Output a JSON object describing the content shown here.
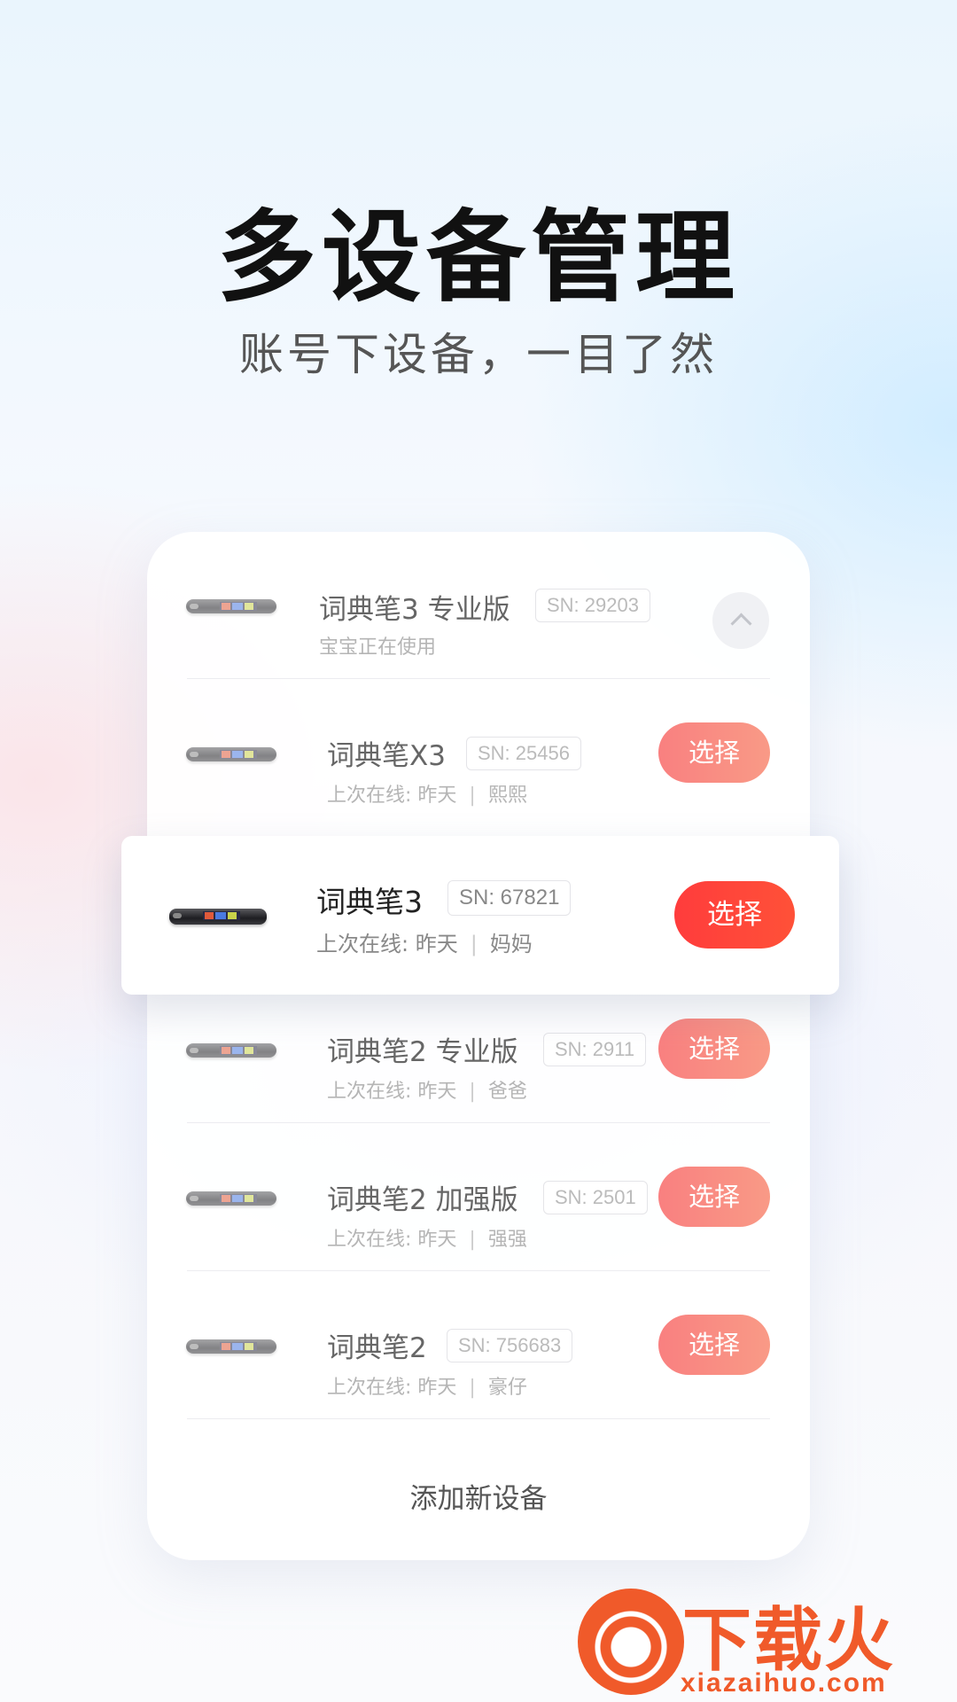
{
  "hero": {
    "title": "多设备管理",
    "subtitle": "账号下设备，一目了然"
  },
  "current_device": {
    "name": "词典笔3 专业版",
    "sn": "SN: 29203",
    "status": "宝宝正在使用"
  },
  "devices": [
    {
      "name": "词典笔X3",
      "sn": "SN: 25456",
      "last_online": "上次在线: 昨天",
      "separator": "|",
      "user": "熙熙",
      "button": "选择"
    },
    {
      "name": "词典笔3",
      "sn": "SN: 67821",
      "last_online": "上次在线: 昨天",
      "separator": "|",
      "user": "妈妈",
      "button": "选择"
    },
    {
      "name": "词典笔2 专业版",
      "sn": "SN: 2911",
      "last_online": "上次在线: 昨天",
      "separator": "|",
      "user": "爸爸",
      "button": "选择"
    },
    {
      "name": "词典笔2 加强版",
      "sn": "SN: 2501",
      "last_online": "上次在线: 昨天",
      "separator": "|",
      "user": "强强",
      "button": "选择"
    },
    {
      "name": "词典笔2",
      "sn": "SN: 756683",
      "last_online": "上次在线: 昨天",
      "separator": "|",
      "user": "豪仔",
      "button": "选择"
    }
  ],
  "add_device_label": "添加新设备",
  "watermark": {
    "brand": "下载火",
    "url": "xiazaihuo.com"
  },
  "colors": {
    "accent": "#ff3c3c",
    "button_light": "#f98080",
    "watermark": "#f05a2a"
  },
  "icons": {
    "collapse": "chevron-up-icon",
    "device": "pen-device-image"
  }
}
